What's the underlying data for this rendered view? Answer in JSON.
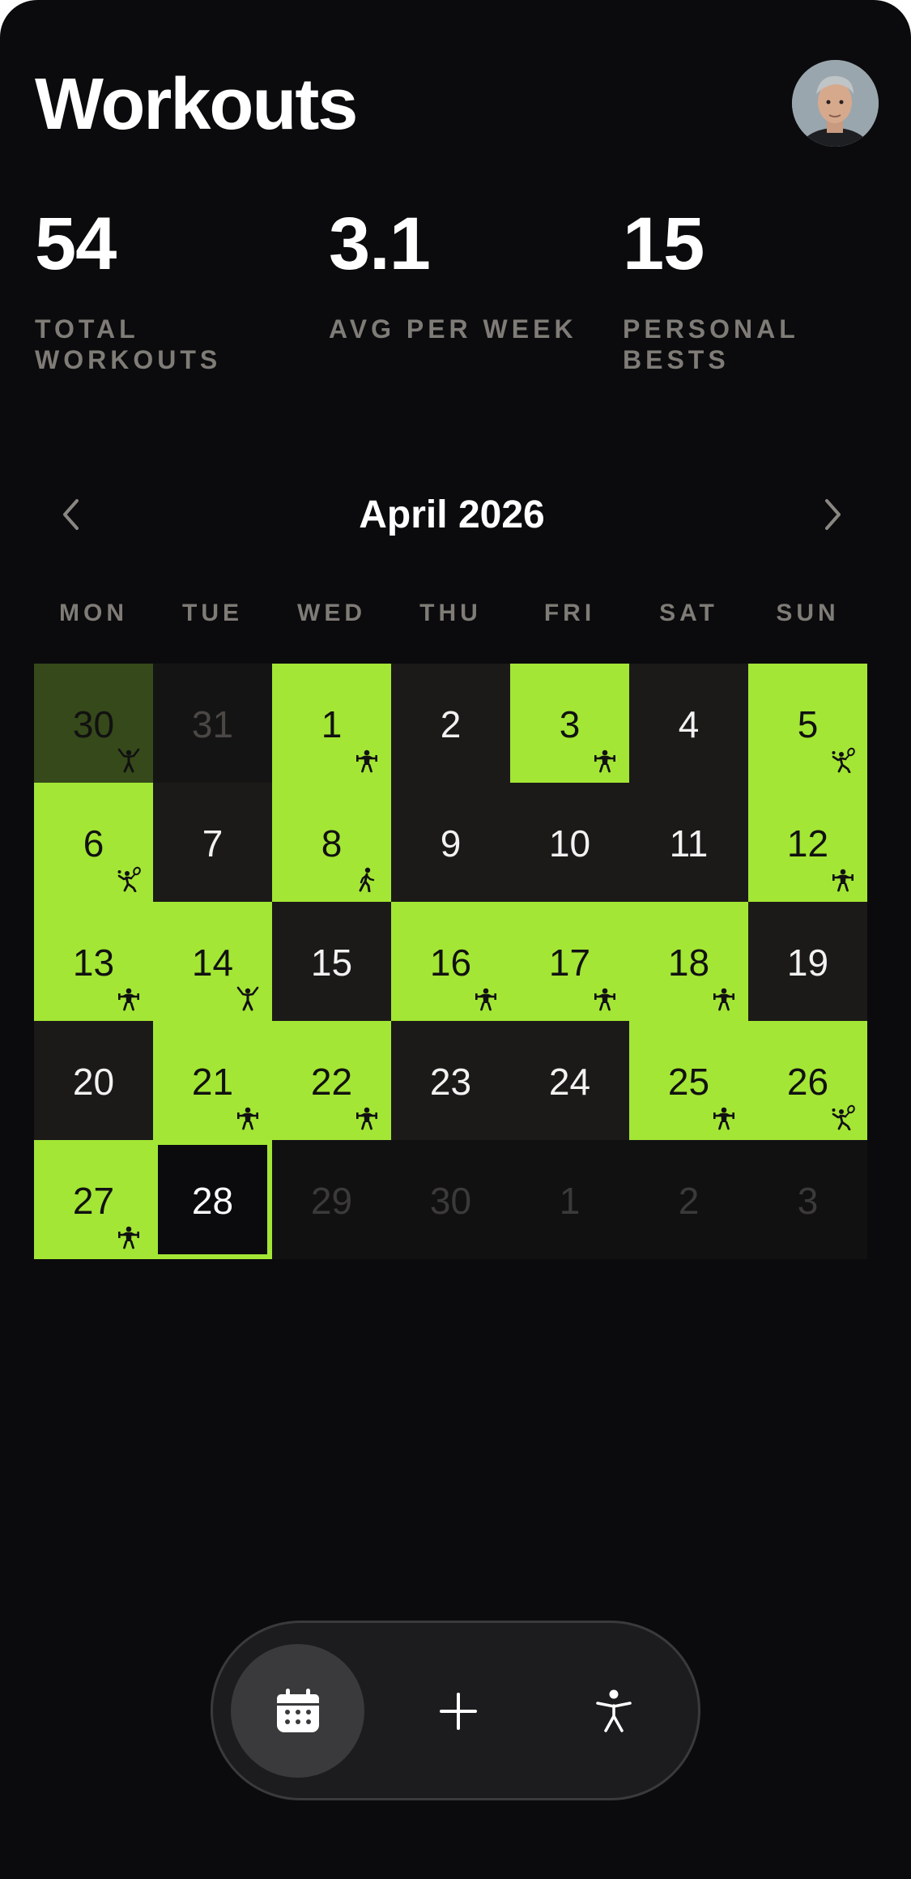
{
  "header": {
    "title": "Workouts"
  },
  "stats": [
    {
      "value": "54",
      "label": "TOTAL WORKOUTS"
    },
    {
      "value": "3.1",
      "label": "AVG PER WEEK"
    },
    {
      "value": "15",
      "label": "PERSONAL BESTS"
    }
  ],
  "calendar": {
    "month_label": "April 2026",
    "weekdays": [
      "MON",
      "TUE",
      "WED",
      "THU",
      "FRI",
      "SAT",
      "SUN"
    ],
    "weeks": [
      [
        {
          "day": "30",
          "state": "dimmed",
          "icon": "stretch-icon"
        },
        {
          "day": "31",
          "state": "prev",
          "icon": ""
        },
        {
          "day": "1",
          "state": "on",
          "icon": "weightlifting-icon"
        },
        {
          "day": "2",
          "state": "off",
          "icon": ""
        },
        {
          "day": "3",
          "state": "on",
          "icon": "weightlifting-icon"
        },
        {
          "day": "4",
          "state": "off",
          "icon": ""
        },
        {
          "day": "5",
          "state": "on",
          "icon": "tennis-icon"
        }
      ],
      [
        {
          "day": "6",
          "state": "on",
          "icon": "tennis-icon"
        },
        {
          "day": "7",
          "state": "off",
          "icon": ""
        },
        {
          "day": "8",
          "state": "on",
          "icon": "walking-icon"
        },
        {
          "day": "9",
          "state": "off",
          "icon": ""
        },
        {
          "day": "10",
          "state": "off",
          "icon": ""
        },
        {
          "day": "11",
          "state": "off",
          "icon": ""
        },
        {
          "day": "12",
          "state": "on",
          "icon": "weightlifting-icon"
        }
      ],
      [
        {
          "day": "13",
          "state": "on",
          "icon": "weightlifting-icon"
        },
        {
          "day": "14",
          "state": "on",
          "icon": "stretch-icon"
        },
        {
          "day": "15",
          "state": "off",
          "icon": ""
        },
        {
          "day": "16",
          "state": "on",
          "icon": "weightlifting-icon"
        },
        {
          "day": "17",
          "state": "on",
          "icon": "weightlifting-icon"
        },
        {
          "day": "18",
          "state": "on",
          "icon": "weightlifting-icon"
        },
        {
          "day": "19",
          "state": "off",
          "icon": ""
        }
      ],
      [
        {
          "day": "20",
          "state": "off",
          "icon": ""
        },
        {
          "day": "21",
          "state": "on",
          "icon": "weightlifting-icon"
        },
        {
          "day": "22",
          "state": "on",
          "icon": "weightlifting-icon"
        },
        {
          "day": "23",
          "state": "off",
          "icon": ""
        },
        {
          "day": "24",
          "state": "off",
          "icon": ""
        },
        {
          "day": "25",
          "state": "on",
          "icon": "weightlifting-icon"
        },
        {
          "day": "26",
          "state": "on",
          "icon": "tennis-icon"
        }
      ],
      [
        {
          "day": "27",
          "state": "on",
          "icon": "weightlifting-icon"
        },
        {
          "day": "28",
          "state": "today",
          "icon": ""
        },
        {
          "day": "29",
          "state": "next",
          "icon": ""
        },
        {
          "day": "30",
          "state": "next",
          "icon": ""
        },
        {
          "day": "1",
          "state": "next",
          "icon": ""
        },
        {
          "day": "2",
          "state": "next",
          "icon": ""
        },
        {
          "day": "3",
          "state": "next",
          "icon": ""
        }
      ]
    ]
  },
  "tabbar": {
    "tabs": [
      {
        "icon": "calendar-icon",
        "active": true
      },
      {
        "icon": "plus-icon",
        "active": false
      },
      {
        "icon": "person-icon",
        "active": false
      }
    ]
  },
  "colors": {
    "accent": "#a3e635",
    "background": "#0b0b0d",
    "cell_off": "#1c1a18",
    "muted_text": "#7f7b76"
  }
}
